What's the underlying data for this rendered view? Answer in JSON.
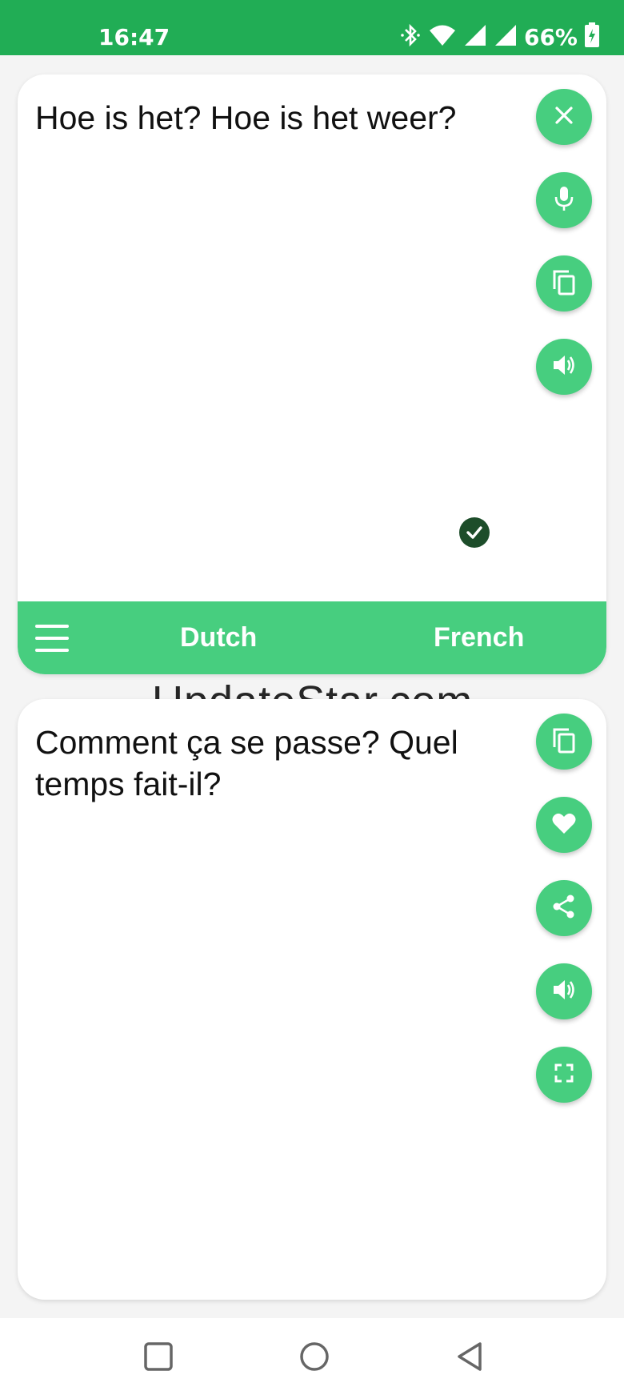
{
  "status_bar": {
    "time": "16:47",
    "battery": "66%",
    "icons": [
      "bluetooth-icon",
      "wifi-icon",
      "signal-icon",
      "signal-icon",
      "battery-charging-icon"
    ],
    "background": "#21ad55"
  },
  "source_panel": {
    "text": "Hoe is het? Hoe is het weer?",
    "actions": [
      "close-icon",
      "microphone-icon",
      "copy-icon",
      "speaker-icon"
    ]
  },
  "language_bar": {
    "source_language": "Dutch",
    "target_language": "French",
    "selected": "French",
    "menu_icon": "hamburger-menu-icon"
  },
  "watermark": "UpdateStar.com",
  "target_panel": {
    "text": "Comment ça se passe? Quel temps fait-il?",
    "actions": [
      "copy-icon",
      "heart-icon",
      "share-icon",
      "speaker-icon",
      "fullscreen-icon"
    ]
  },
  "nav_bar": {
    "buttons": [
      "recents-square-icon",
      "home-circle-icon",
      "back-triangle-icon"
    ]
  },
  "colors": {
    "accent": "#47ce7f",
    "status_bar": "#21ad55",
    "check_badge": "#1d4d2a"
  }
}
